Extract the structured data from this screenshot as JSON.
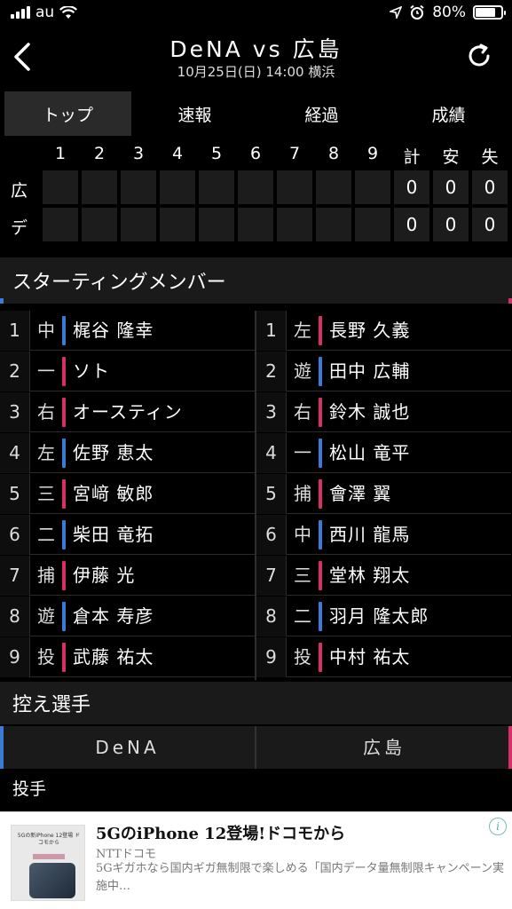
{
  "status_bar": {
    "carrier": "au",
    "battery": "80%",
    "battery_level": 0.8
  },
  "header": {
    "title": "DeNA vs 広島",
    "subtitle": "10月25日(日) 14:00 横浜"
  },
  "tabs": [
    {
      "label": "トップ",
      "active": true
    },
    {
      "label": "速報",
      "active": false
    },
    {
      "label": "経過",
      "active": false
    },
    {
      "label": "成績",
      "active": false
    }
  ],
  "scoreboard": {
    "innings": [
      "1",
      "2",
      "3",
      "4",
      "5",
      "6",
      "7",
      "8",
      "9"
    ],
    "totals_headers": [
      "計",
      "安",
      "失"
    ],
    "teams": [
      {
        "abbr": "広",
        "totals": [
          "0",
          "0",
          "0"
        ]
      },
      {
        "abbr": "デ",
        "totals": [
          "0",
          "0",
          "0"
        ]
      }
    ]
  },
  "starting": {
    "title": "スターティングメンバー",
    "left": [
      {
        "num": "1",
        "pos": "中",
        "name": "梶谷 隆幸",
        "color": "blue"
      },
      {
        "num": "2",
        "pos": "一",
        "name": "ソト",
        "color": "red"
      },
      {
        "num": "3",
        "pos": "右",
        "name": "オースティン",
        "color": "red"
      },
      {
        "num": "4",
        "pos": "左",
        "name": "佐野 恵太",
        "color": "blue"
      },
      {
        "num": "5",
        "pos": "三",
        "name": "宮﨑 敏郎",
        "color": "red"
      },
      {
        "num": "6",
        "pos": "二",
        "name": "柴田 竜拓",
        "color": "blue"
      },
      {
        "num": "7",
        "pos": "捕",
        "name": "伊藤 光",
        "color": "red"
      },
      {
        "num": "8",
        "pos": "遊",
        "name": "倉本 寿彦",
        "color": "blue"
      },
      {
        "num": "9",
        "pos": "投",
        "name": "武藤 祐太",
        "color": "red"
      }
    ],
    "right": [
      {
        "num": "1",
        "pos": "左",
        "name": "長野 久義",
        "color": "red"
      },
      {
        "num": "2",
        "pos": "遊",
        "name": "田中 広輔",
        "color": "blue"
      },
      {
        "num": "3",
        "pos": "右",
        "name": "鈴木 誠也",
        "color": "red"
      },
      {
        "num": "4",
        "pos": "一",
        "name": "松山 竜平",
        "color": "blue"
      },
      {
        "num": "5",
        "pos": "捕",
        "name": "會澤 翼",
        "color": "red"
      },
      {
        "num": "6",
        "pos": "中",
        "name": "西川 龍馬",
        "color": "blue"
      },
      {
        "num": "7",
        "pos": "三",
        "name": "堂林 翔太",
        "color": "red"
      },
      {
        "num": "8",
        "pos": "二",
        "name": "羽月 隆太郎",
        "color": "blue"
      },
      {
        "num": "9",
        "pos": "投",
        "name": "中村 祐太",
        "color": "red"
      }
    ]
  },
  "bench": {
    "title": "控え選手",
    "teams": [
      "DeNA",
      "広島"
    ],
    "category": "投手"
  },
  "ad": {
    "thumb_text": "5Gの新iPhone 12登場 ドコモから",
    "headline": "5GのiPhone 12登場!ドコモから",
    "sponsor": "NTTドコモ",
    "description": "5Gギガホなら国内ギガ無制限で楽しめる「国内データ量無制限キャンペーン実施中…",
    "info_icon": "i"
  },
  "colors": {
    "blue": "#3b7bd6",
    "red": "#d6306b",
    "tab_active": "#2a2a2a"
  },
  "icons": [
    "signal-icon",
    "wifi-icon",
    "location-icon",
    "alarm-icon",
    "battery-icon",
    "back-chevron-icon",
    "refresh-icon",
    "ad-info-icon"
  ]
}
